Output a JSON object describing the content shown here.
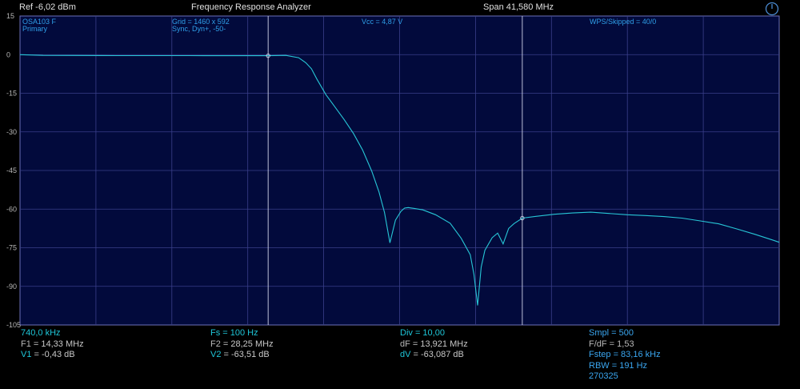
{
  "header": {
    "ref": "Ref  -6,02 dBm",
    "title": "Frequency Response Analyzer",
    "span": "Span 41,580 MHz"
  },
  "overlay": {
    "device": "OSA103 F",
    "channel": "Primary",
    "grid": "Grid = 1460 x 592",
    "sync": "Sync,  Dyn+,  -50-",
    "vcc": "Vcc = 4,87 V",
    "wps": "WPS/Skipped  = 40/0"
  },
  "colors": {
    "trace": "#27c6d6",
    "grid": "#3a3f8a",
    "plot_bg": "#020a3c",
    "marker": "#d0d4e8"
  },
  "footer": {
    "col1": {
      "start": "740,0 kHz",
      "f1_label": "F1",
      "f1_value": "= 14,33 MHz",
      "v1_label": "V1",
      "v1_value": "= -0,43 dB"
    },
    "col2": {
      "fs_label": "Fs",
      "fs_value": "= 100 Hz",
      "f2_label": "F2",
      "f2_value": "= 28,25 MHz",
      "v2_label": "V2",
      "v2_value": "= -63,51 dB"
    },
    "col3": {
      "div_label": "Div",
      "div_value": "= 10,00",
      "df_label": "dF",
      "df_value": "= 13,921 MHz",
      "dv_label": "dV",
      "dv_value": "= -63,087 dB"
    },
    "col4": {
      "smpl": "Smpl = 500",
      "fdf": "F/dF = 1,53",
      "fstep": "Fstep = 83,16 kHz",
      "rbw": "RBW = 191 Hz",
      "date": "270325"
    }
  },
  "chart_data": {
    "type": "line",
    "x_unit": "MHz",
    "xlim": [
      0.74,
      42.32
    ],
    "ylim": [
      -105,
      15
    ],
    "yticks": [
      15,
      0,
      -15,
      -30,
      -45,
      -60,
      -75,
      -90,
      -105
    ],
    "grid": true,
    "markers": [
      {
        "name": "F1",
        "x": 14.33,
        "y": -0.43
      },
      {
        "name": "F2",
        "x": 28.25,
        "y": -63.51
      }
    ],
    "series": [
      {
        "x": [
          0.74,
          2.0,
          6.0,
          10.0,
          14.33,
          15.3,
          16.0,
          16.4,
          16.7,
          17.0,
          17.5,
          18.0,
          18.5,
          19.0,
          19.5,
          20.0,
          20.4,
          20.7,
          21.0,
          21.3,
          21.6,
          21.8,
          22.0,
          22.3,
          22.8,
          23.5,
          24.3,
          24.9,
          25.4,
          25.6,
          25.8,
          26.0,
          26.2,
          26.6,
          26.9,
          27.2,
          27.5,
          27.8,
          28.25,
          29.0,
          30.0,
          31.0,
          32.0,
          33.0,
          34.0,
          35.0,
          36.0,
          37.0,
          38.0,
          39.0,
          40.0,
          41.0,
          42.0,
          42.32
        ],
        "y": [
          0,
          -0.3,
          -0.4,
          -0.4,
          -0.43,
          -0.3,
          -1.2,
          -3.2,
          -5.5,
          -9.5,
          -15.6,
          -20.4,
          -25.3,
          -30.6,
          -37.0,
          -45.2,
          -53.3,
          -61.3,
          -73.1,
          -64.3,
          -60.9,
          -59.6,
          -59.4,
          -59.7,
          -60.3,
          -62.2,
          -65.5,
          -71.3,
          -77.7,
          -85.3,
          -97.4,
          -82.5,
          -76.0,
          -71.1,
          -69.3,
          -73.5,
          -67.5,
          -65.6,
          -63.51,
          -62.8,
          -62.0,
          -61.5,
          -61.2,
          -61.7,
          -62.2,
          -62.5,
          -62.9,
          -63.5,
          -64.6,
          -65.7,
          -67.7,
          -69.8,
          -72.1,
          -72.9
        ]
      }
    ]
  }
}
